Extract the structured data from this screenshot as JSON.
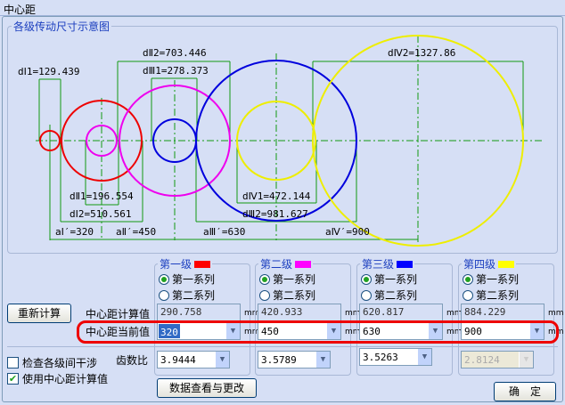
{
  "window": {
    "title": "中心距"
  },
  "diagram": {
    "title": "各级传动尺寸示意图",
    "labels": {
      "dI1": "dⅠ1=129.439",
      "dII2": "dⅡ2=703.446",
      "dIII1": "dⅢ1=278.373",
      "dIV2": "dⅣ2=1327.86",
      "dII1": "dⅡ1=196.554",
      "dIV1": "dⅣ1=472.144",
      "dI2": "dⅠ2=510.561",
      "dIII2": "dⅢ2=981.627",
      "aI": "aⅠ′=320",
      "aII": "aⅡ′=450",
      "aIII": "aⅢ′=630",
      "aIV": "aⅣ′=900"
    }
  },
  "stages": [
    {
      "title": "第一级",
      "color": "#ff0000",
      "series1": "第一系列",
      "series2": "第二系列",
      "series_selected": 1,
      "calc": "290.758",
      "current": "320",
      "ratio": "3.9444",
      "ratio_enabled": true
    },
    {
      "title": "第二级",
      "color": "#ff00ff",
      "series1": "第一系列",
      "series2": "第二系列",
      "series_selected": 1,
      "calc": "420.933",
      "current": "450",
      "ratio": "3.5789",
      "ratio_enabled": true
    },
    {
      "title": "第三级",
      "color": "#0000ff",
      "series1": "第一系列",
      "series2": "第二系列",
      "series_selected": 1,
      "calc": "620.817",
      "current": "630",
      "ratio": "3.5263",
      "ratio_enabled": true
    },
    {
      "title": "第四级",
      "color": "#ffff00",
      "series1": "第一系列",
      "series2": "第二系列",
      "series_selected": 1,
      "calc": "884.229",
      "current": "900",
      "ratio": "2.8124",
      "ratio_enabled": false
    }
  ],
  "unit": "mm",
  "labels": {
    "calc": "中心距计算值",
    "current": "中心距当前值",
    "ratio": "齿数比"
  },
  "buttons": {
    "recalc": "重新计算",
    "data_view": "数据查看与更改",
    "ok": "确　定"
  },
  "checkboxes": {
    "interference": {
      "label": "检查各级间干涉",
      "checked": false
    },
    "use_calc": {
      "label": "使用中心距计算值",
      "checked": true
    }
  }
}
